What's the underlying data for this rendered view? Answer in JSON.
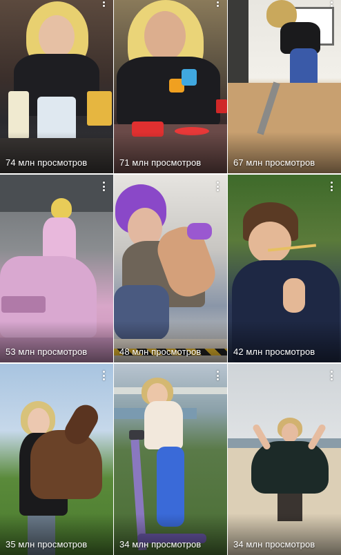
{
  "grid": {
    "tiles": [
      {
        "views": "74 млн просмотров",
        "menu_icon": "more-vertical-icon"
      },
      {
        "views": "71 млн просмотров",
        "menu_icon": "more-vertical-icon"
      },
      {
        "views": "67 млн просмотров",
        "menu_icon": "more-vertical-icon"
      },
      {
        "views": "53 млн просмотров",
        "menu_icon": "more-vertical-icon"
      },
      {
        "views": "48 млн просмотров",
        "menu_icon": "more-vertical-icon"
      },
      {
        "views": "42 млн просмотров",
        "menu_icon": "more-vertical-icon"
      },
      {
        "views": "35 млн просмотров",
        "menu_icon": "more-vertical-icon"
      },
      {
        "views": "34 млн просмотров",
        "menu_icon": "more-vertical-icon"
      },
      {
        "views": "34 млн просмотров",
        "menu_icon": "more-vertical-icon"
      }
    ],
    "text_color": "#ffffff"
  }
}
